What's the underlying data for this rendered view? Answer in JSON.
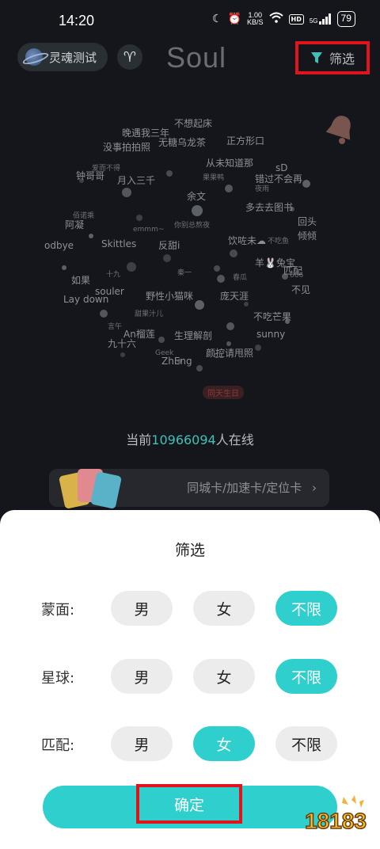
{
  "status_bar": {
    "time": "14:20",
    "net_speed_value": "1.00",
    "net_speed_unit": "KB/S",
    "hd_badge": "HD",
    "signal_label": "5G",
    "battery": "79"
  },
  "top_bar": {
    "soul_test_label": "灵魂测试",
    "aries_symbol": "♈",
    "logo": "Soul",
    "filter_label": "筛选"
  },
  "planet": {
    "labels": [
      {
        "text": "不想起床",
        "size": "n"
      },
      {
        "text": "晚遇我三年",
        "size": "n"
      },
      {
        "text": "无糖乌龙茶",
        "size": "n"
      },
      {
        "text": "正方形口",
        "size": "n"
      },
      {
        "text": "没事拍拍照",
        "size": "n"
      },
      {
        "text": "爱而不得",
        "size": "s"
      },
      {
        "text": "钟哥哥",
        "size": "n"
      },
      {
        "text": "月入三千",
        "size": "n"
      },
      {
        "text": "从未知道那",
        "size": "n"
      },
      {
        "text": "sD",
        "size": "n"
      },
      {
        "text": "果果鸭",
        "size": "s"
      },
      {
        "text": "错过不会再",
        "size": "n"
      },
      {
        "text": "夜雨",
        "size": "s"
      },
      {
        "text": "余文",
        "size": "n"
      },
      {
        "text": "佰诺乘",
        "size": "s"
      },
      {
        "text": "多去去图书",
        "size": "n"
      },
      {
        "text": "阿凝",
        "size": "n"
      },
      {
        "text": "回头",
        "size": "n"
      },
      {
        "text": "emmm~",
        "size": "s"
      },
      {
        "text": "你别总熬夜",
        "size": "s"
      },
      {
        "text": "倾倾",
        "size": "n"
      },
      {
        "text": "odbye",
        "size": "n"
      },
      {
        "text": "Skittles",
        "size": "n"
      },
      {
        "text": "反甜i",
        "size": "n"
      },
      {
        "text": "饮咗未☁",
        "size": "n"
      },
      {
        "text": "不吃鱼",
        "size": "s"
      },
      {
        "text": "羊🐰兔宝",
        "size": "n"
      },
      {
        "text": "如果",
        "size": "n"
      },
      {
        "text": "十九",
        "size": "s"
      },
      {
        "text": "秦一",
        "size": "s"
      },
      {
        "text": "春瓜",
        "size": "s"
      },
      {
        "text": "666",
        "size": "s"
      },
      {
        "text": "匹配",
        "size": "n"
      },
      {
        "text": "souler",
        "size": "n"
      },
      {
        "text": "Lay down",
        "size": "n"
      },
      {
        "text": "野性小猫咪",
        "size": "n"
      },
      {
        "text": "庞天涯",
        "size": "n"
      },
      {
        "text": "不见",
        "size": "n"
      },
      {
        "text": "甜果汁儿",
        "size": "s"
      },
      {
        "text": "不吃芒果",
        "size": "n"
      },
      {
        "text": "言午",
        "size": "s"
      },
      {
        "text": "An榴莲",
        "size": "n"
      },
      {
        "text": "生理解剖",
        "size": "n"
      },
      {
        "text": "sunny",
        "size": "n"
      },
      {
        "text": "九十六",
        "size": "n"
      },
      {
        "text": "Geek",
        "size": "s"
      },
      {
        "text": "颜控请甩照",
        "size": "n"
      },
      {
        "text": "ZhEng",
        "size": "n"
      },
      {
        "text": "CC",
        "size": "s"
      },
      {
        "text": "同天生日",
        "size": "tag"
      }
    ]
  },
  "online": {
    "prefix": "当前",
    "count": "10966094",
    "suffix": "人在线"
  },
  "card_banner": {
    "text": "同城卡/加速卡/定位卡",
    "chevron": "›"
  },
  "sheet": {
    "title": "筛选",
    "rows": [
      {
        "label": "蒙面:",
        "options": [
          "男",
          "女",
          "不限"
        ],
        "selected": "不限"
      },
      {
        "label": "星球:",
        "options": [
          "男",
          "女",
          "不限"
        ],
        "selected": "不限"
      },
      {
        "label": "匹配:",
        "options": [
          "男",
          "女",
          "不限"
        ],
        "selected": "女"
      }
    ],
    "confirm_label": "确定"
  },
  "watermark": {
    "text": "18183"
  },
  "colors": {
    "accent": "#2ecfcc",
    "highlight_box": "#e0141c",
    "online_count": "#3fc1b9"
  }
}
